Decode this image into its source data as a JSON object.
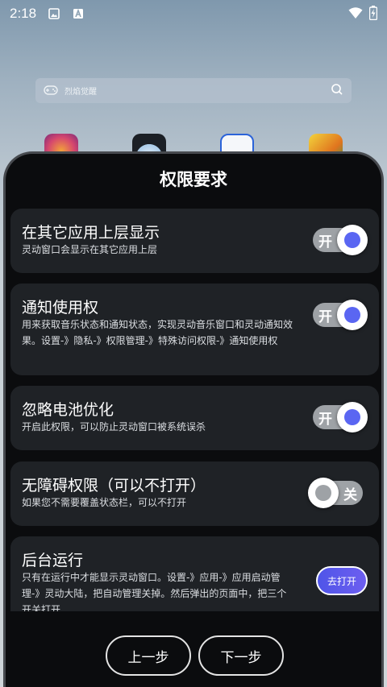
{
  "status_bar": {
    "time": "2:18",
    "icons": [
      "image-icon",
      "font-a-icon",
      "wifi-icon",
      "battery-charging-icon"
    ]
  },
  "search": {
    "placeholder": "烈焰觉醒",
    "left_icon": "gamepad-icon",
    "right_icon": "search-icon"
  },
  "dialog": {
    "title": "权限要求",
    "permissions": [
      {
        "title": "在其它应用上层显示",
        "desc": "灵动窗口会显示在其它应用上层",
        "control": "toggle",
        "state": "on",
        "toggle_label": "开"
      },
      {
        "title": "通知使用权",
        "desc": "用来获取音乐状态和通知状态，实现灵动音乐窗口和灵动通知效果。设置-》隐私-》权限管理-》特殊访问权限-》通知使用权",
        "control": "toggle",
        "state": "on",
        "toggle_label": "开"
      },
      {
        "title": "忽略电池优化",
        "desc": "开启此权限，可以防止灵动窗口被系统误杀",
        "control": "toggle",
        "state": "on",
        "toggle_label": "开"
      },
      {
        "title": "无障碍权限（可以不打开）",
        "desc": "如果您不需要覆盖状态栏，可以不打开",
        "control": "toggle",
        "state": "off",
        "toggle_label": "关"
      },
      {
        "title": "后台运行",
        "desc": "只有在运行中才能显示灵动窗口。设置-》应用-》应用启动管理-》灵动大陆，把自动管理关掉。然后弹出的页面中，把三个开关打开",
        "control": "button",
        "button_label": "去打开"
      }
    ],
    "prev_label": "上一步",
    "next_label": "下一步"
  },
  "colors": {
    "accent": "#5a66f2",
    "card_bg": "#1f2226",
    "dialog_bg": "#0b0c0e"
  }
}
